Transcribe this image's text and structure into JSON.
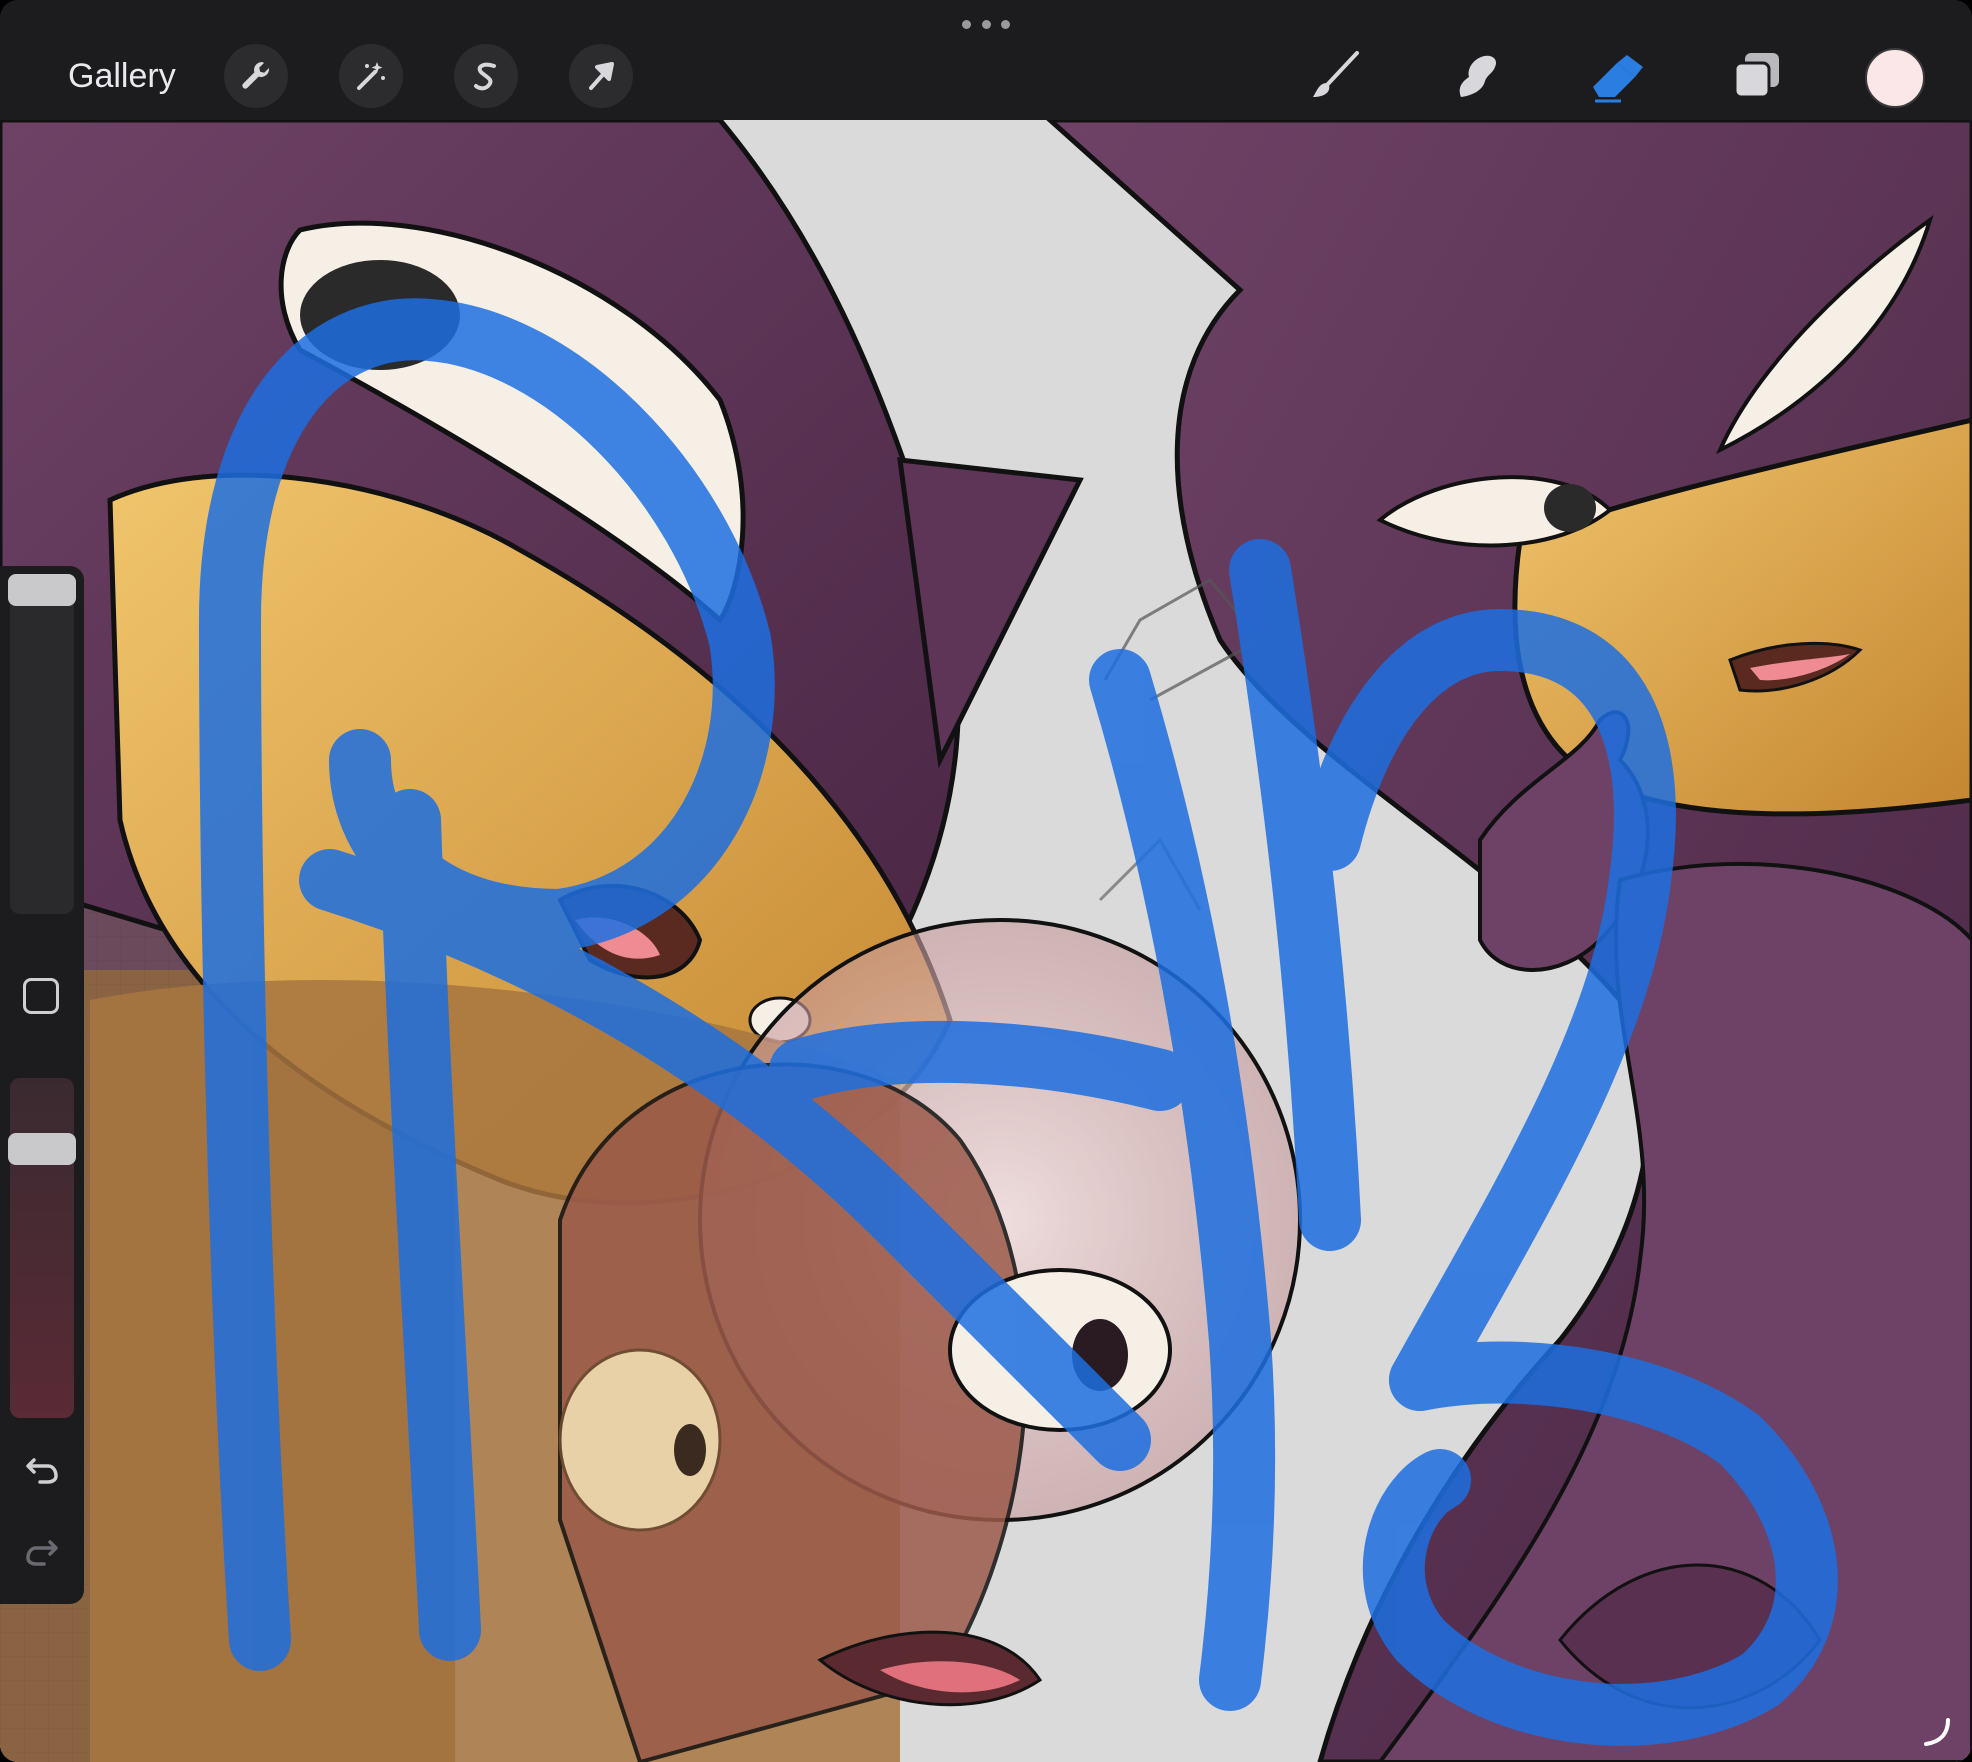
{
  "toolbar": {
    "gallery_label": "Gallery",
    "left_tools": [
      {
        "name": "actions",
        "icon": "wrench-icon"
      },
      {
        "name": "adjustments",
        "icon": "magic-wand-icon"
      },
      {
        "name": "selection",
        "icon": "selection-s-icon"
      },
      {
        "name": "transform",
        "icon": "arrow-cursor-icon"
      }
    ],
    "right_tools": [
      {
        "name": "brush",
        "icon": "brush-icon",
        "active": false
      },
      {
        "name": "smudge",
        "icon": "smudge-finger-icon",
        "active": false
      },
      {
        "name": "eraser",
        "icon": "eraser-icon",
        "active": true
      },
      {
        "name": "layers",
        "icon": "layers-icon",
        "active": false
      }
    ],
    "current_color": "#fbe6e8",
    "active_tool_color": "#2a7de1"
  },
  "sidebar": {
    "brush_size_level": 0.0,
    "brush_opacity_level": 0.18,
    "modify_icon": "square-modify-icon",
    "undo_icon": "undo-arrow-icon",
    "redo_icon": "redo-arrow-icon"
  },
  "canvas": {
    "background_color": "#dadada",
    "primary_art_color": "#5d3355",
    "skin_color": "#e6a84a",
    "stroke_color": "#1d6fe0"
  }
}
